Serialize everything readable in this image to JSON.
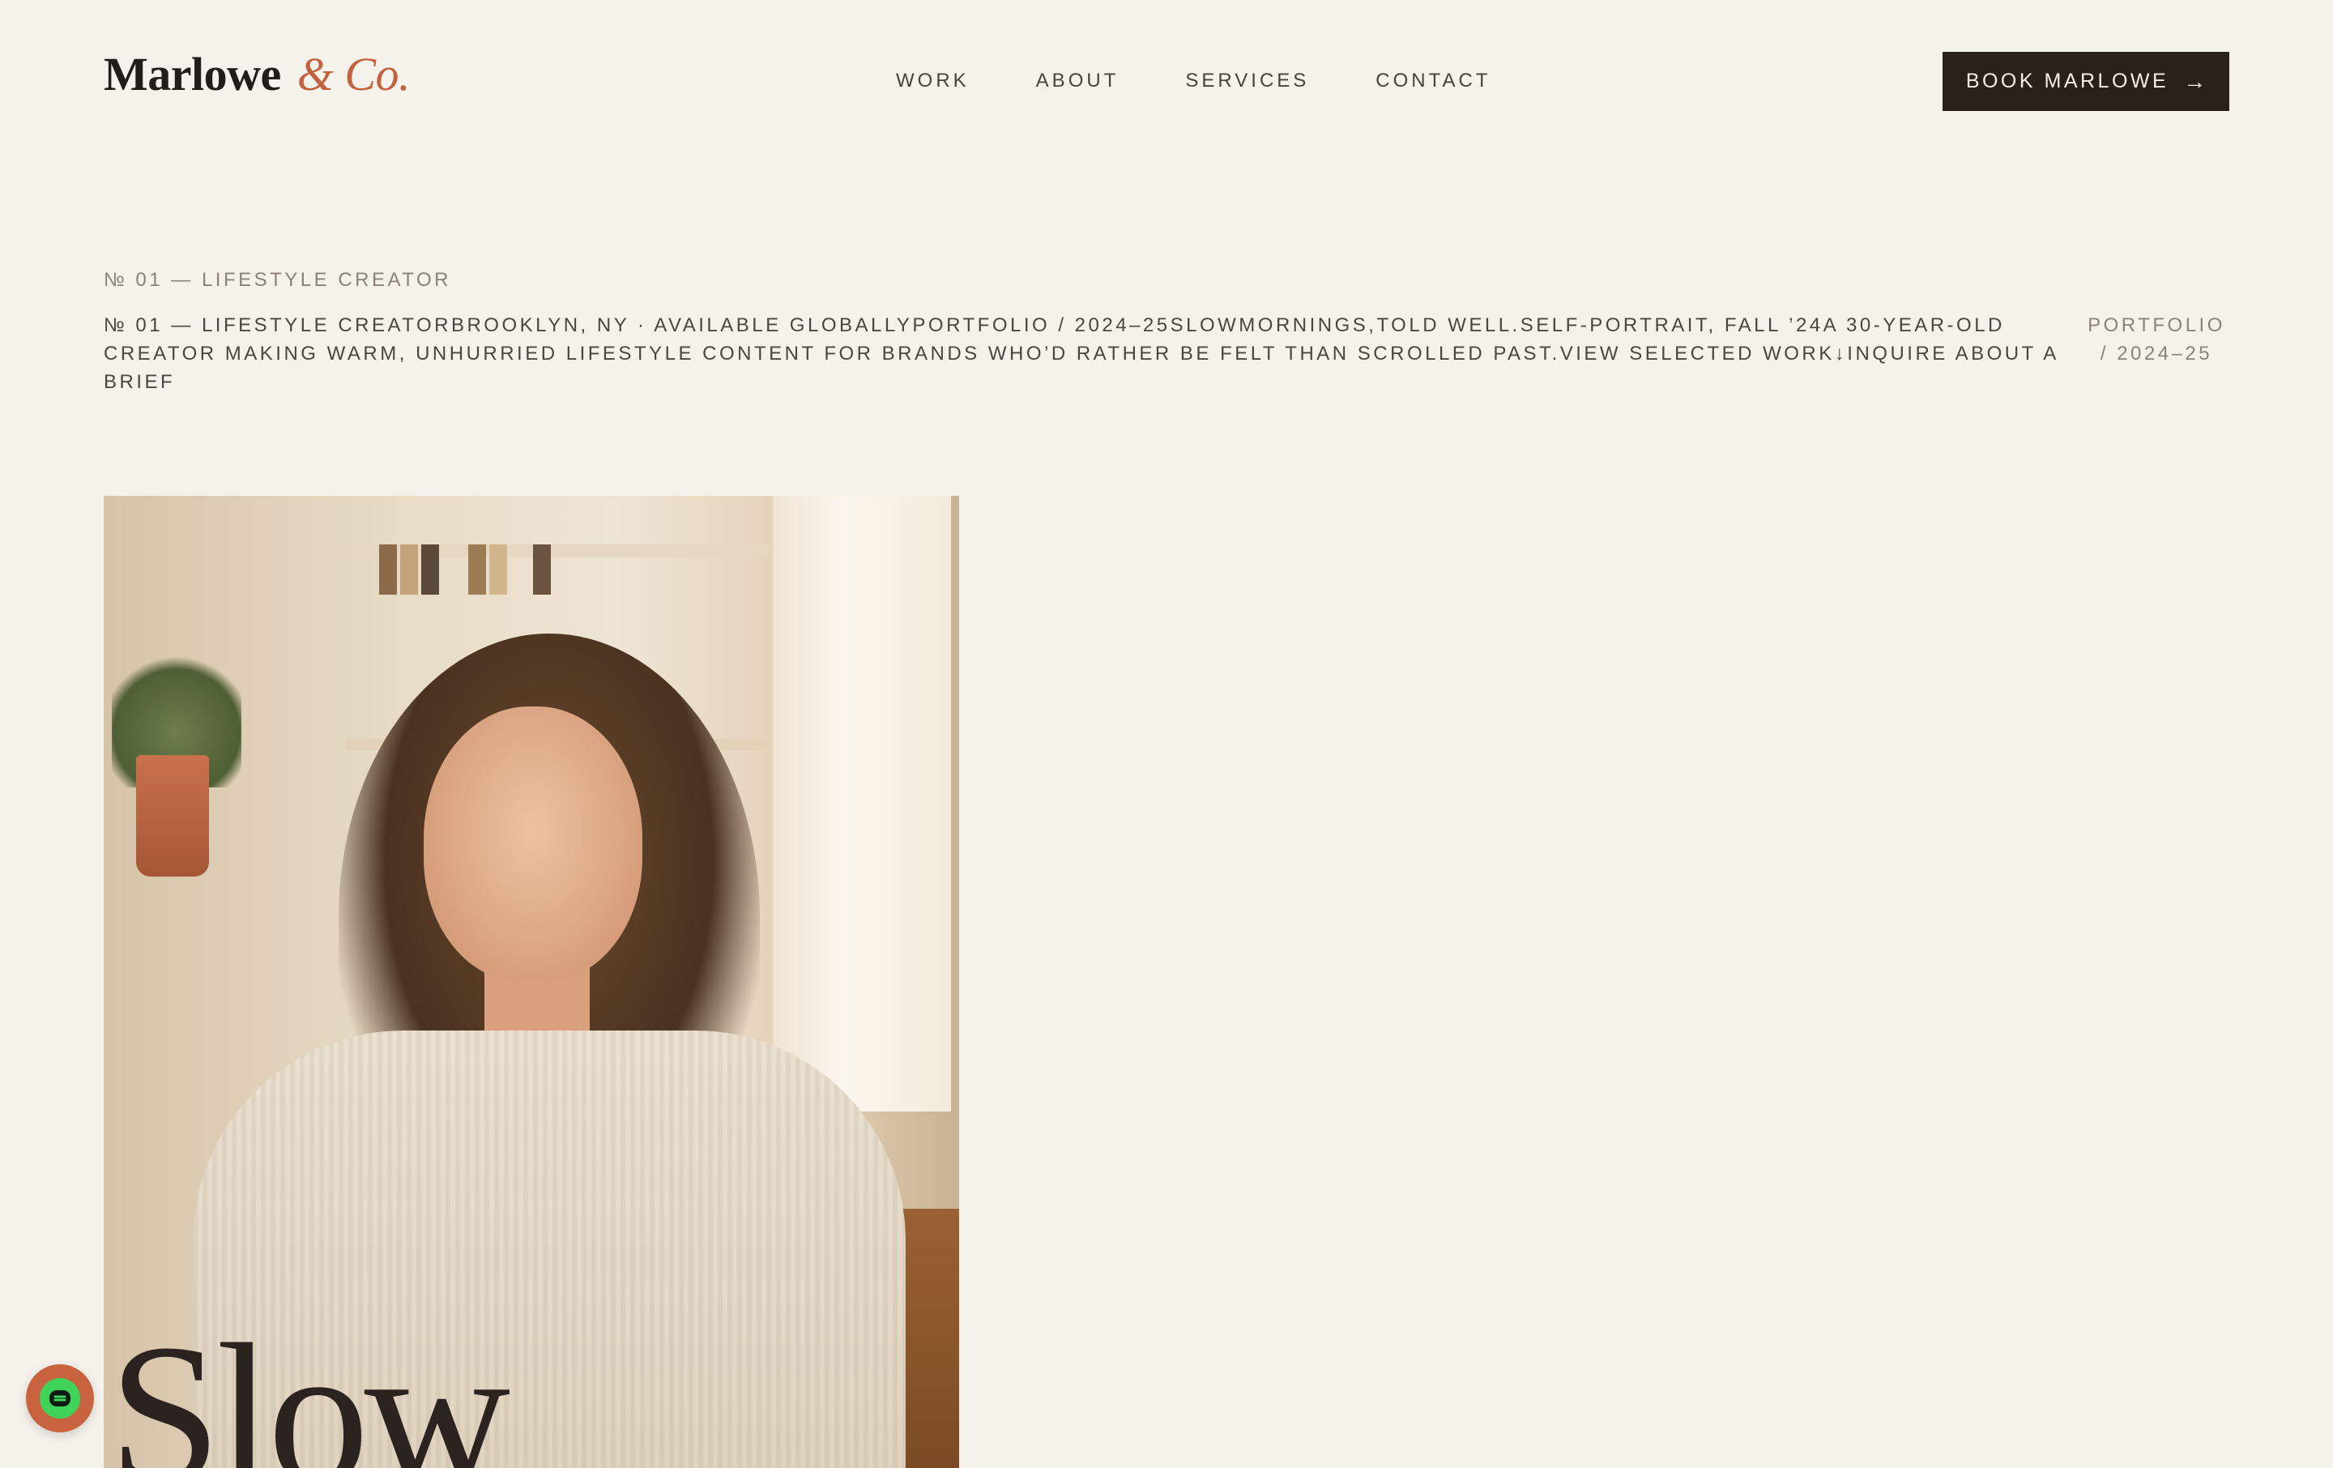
{
  "header": {
    "logo": {
      "name": "Marlowe",
      "suffix": "& Co."
    },
    "nav": [
      {
        "label": "WORK"
      },
      {
        "label": "ABOUT"
      },
      {
        "label": "SERVICES"
      },
      {
        "label": "CONTACT"
      }
    ],
    "cta": {
      "label": "BOOK MARLOWE",
      "arrow": "→"
    }
  },
  "hero": {
    "eyebrow": "№ 01 — LIFESTYLE CREATOR",
    "runon_text": "№ 01 — LIFESTYLE CREATORBROOKLYN, NY · AVAILABLE GLOBALLYPORTFOLIO  /  2024–25SLOWMORNINGS,TOLD WELL.SELF-PORTRAIT, FALL ’24A 30-YEAR-OLD CREATOR MAKING WARM, UNHURRIED LIFESTYLE CONTENT FOR BRANDS WHO’D RATHER BE FELT THAN SCROLLED PAST.VIEW SELECTED WORK↓INQUIRE ABOUT A BRIEF",
    "side_label": "PORTFOLIO / 2024–25",
    "photo_word": "Slow"
  },
  "fab": {
    "icon": "chat-icon"
  },
  "colors": {
    "background": "#f5f1eb",
    "accent": "#c2613e",
    "cta_bg": "#2a211d",
    "fab_inner": "#3fd35a"
  }
}
